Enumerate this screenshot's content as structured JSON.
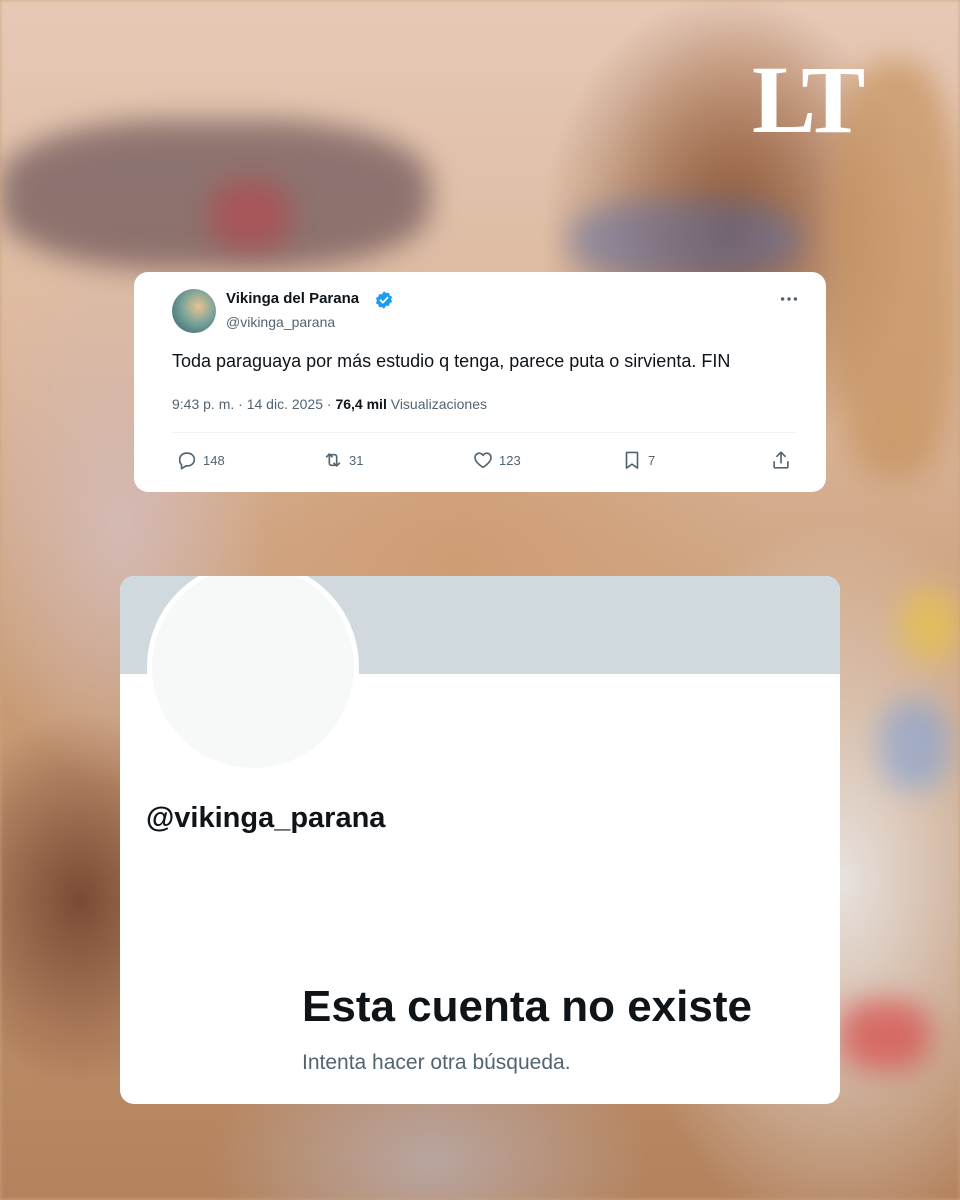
{
  "brand": {
    "logo_text": "LT"
  },
  "tweet": {
    "author_name": "Vikinga del Parana",
    "author_handle": "@vikinga_parana",
    "verified": true,
    "text": "Toda paraguaya por más estudio q tenga, parece puta o sirvienta. FIN",
    "time": "9:43 p. m.",
    "separator": "·",
    "date": "14 dic. 2025",
    "views_count": "76,4 mil",
    "views_label": "Visualizaciones",
    "actions": {
      "replies": "148",
      "reposts": "31",
      "likes": "123",
      "bookmarks": "7"
    },
    "icons": [
      "verified-badge-icon",
      "more-icon",
      "reply-icon",
      "retweet-icon",
      "heart-icon",
      "bookmark-icon",
      "share-icon"
    ],
    "accent_color": "#1d9bf0"
  },
  "profile": {
    "handle": "@vikinga_parana",
    "empty_state_title": "Esta cuenta no existe",
    "empty_state_subtitle": "Intenta hacer otra búsqueda.",
    "banner_color": "#cfd9de"
  }
}
